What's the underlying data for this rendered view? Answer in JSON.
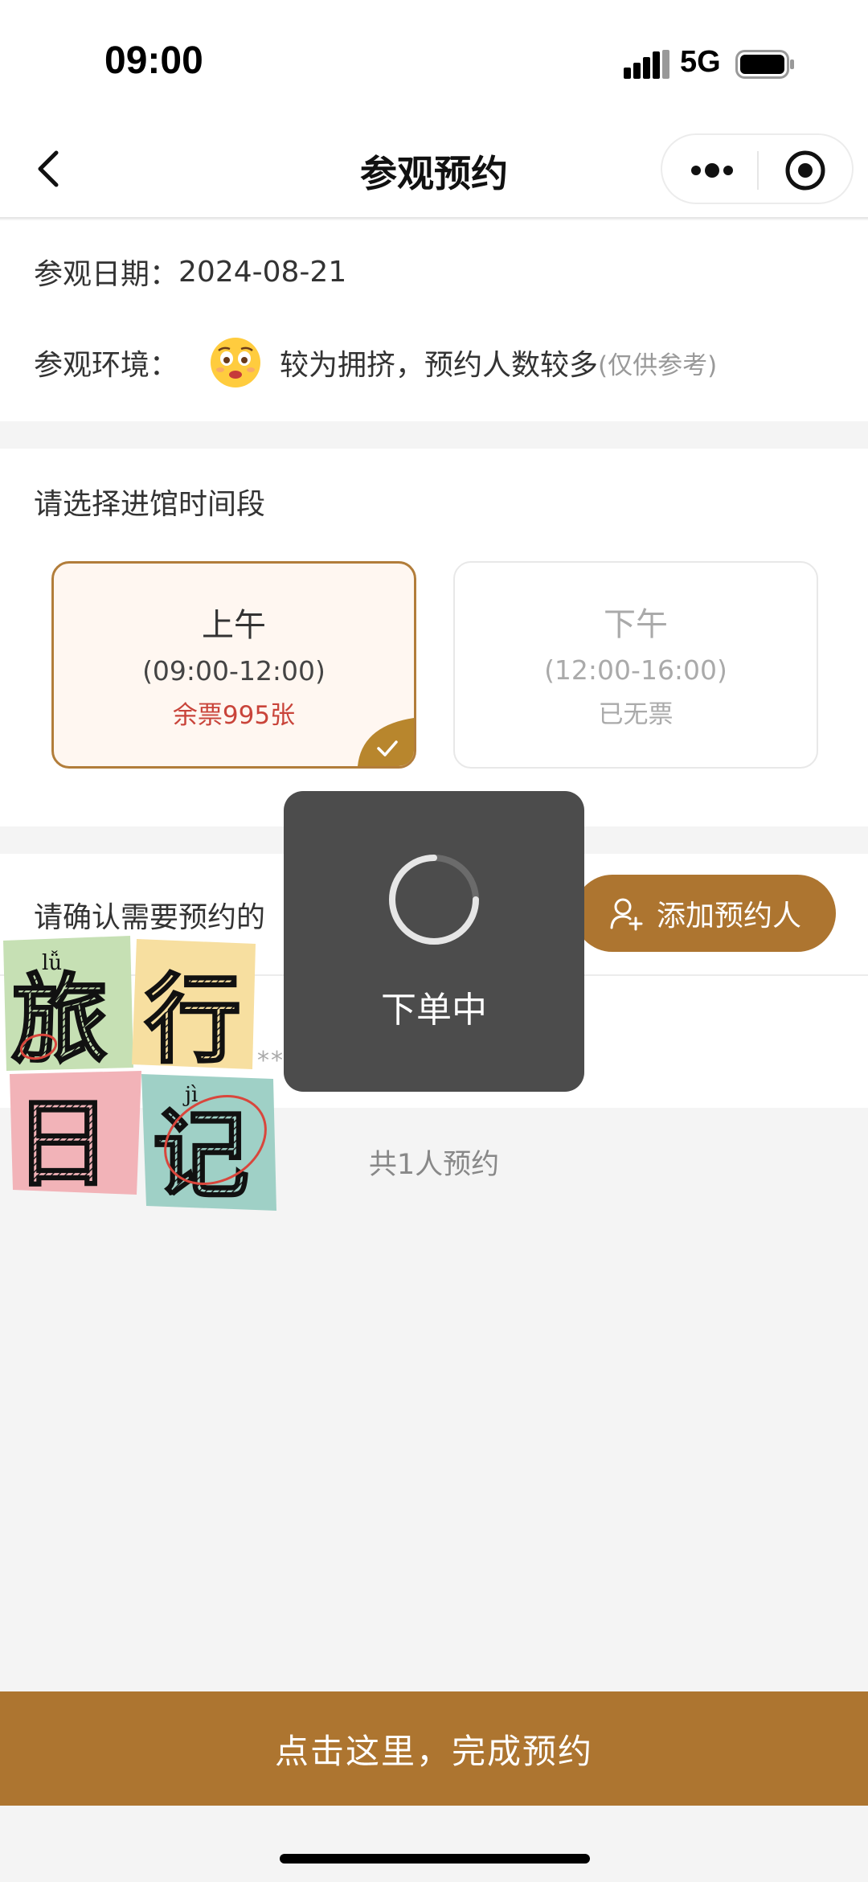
{
  "status_bar": {
    "time": "09:00",
    "network": "5G"
  },
  "nav": {
    "title": "参观预约"
  },
  "visit": {
    "date_label": "参观日期：",
    "date": "2024-08-21",
    "env_label": "参观环境：",
    "env_text": "较为拥挤，预约人数较多",
    "env_note": "(仅供参考)"
  },
  "slots": {
    "title": "请选择进馆时间段",
    "am": {
      "name": "上午",
      "time": "(09:00-12:00)",
      "tickets": "余票995张"
    },
    "pm": {
      "name": "下午",
      "time": "(12:00-16:00)",
      "tickets": "已无票"
    }
  },
  "visitors": {
    "confirm_text": "请确认需要预约的",
    "add_button": "添加预约人",
    "masked_name": "**",
    "total": "共1人预约"
  },
  "toast": {
    "text": "下单中"
  },
  "sticker": {
    "chars": [
      "旅",
      "行",
      "日",
      "记"
    ],
    "pinyin_1": "lǚ",
    "pinyin_2": "jì"
  },
  "bottom_button": "点击这里，完成预约",
  "colors": {
    "accent": "#ad7530",
    "ticket_red": "#c9443a",
    "toast_bg": "#4c4c4c"
  }
}
